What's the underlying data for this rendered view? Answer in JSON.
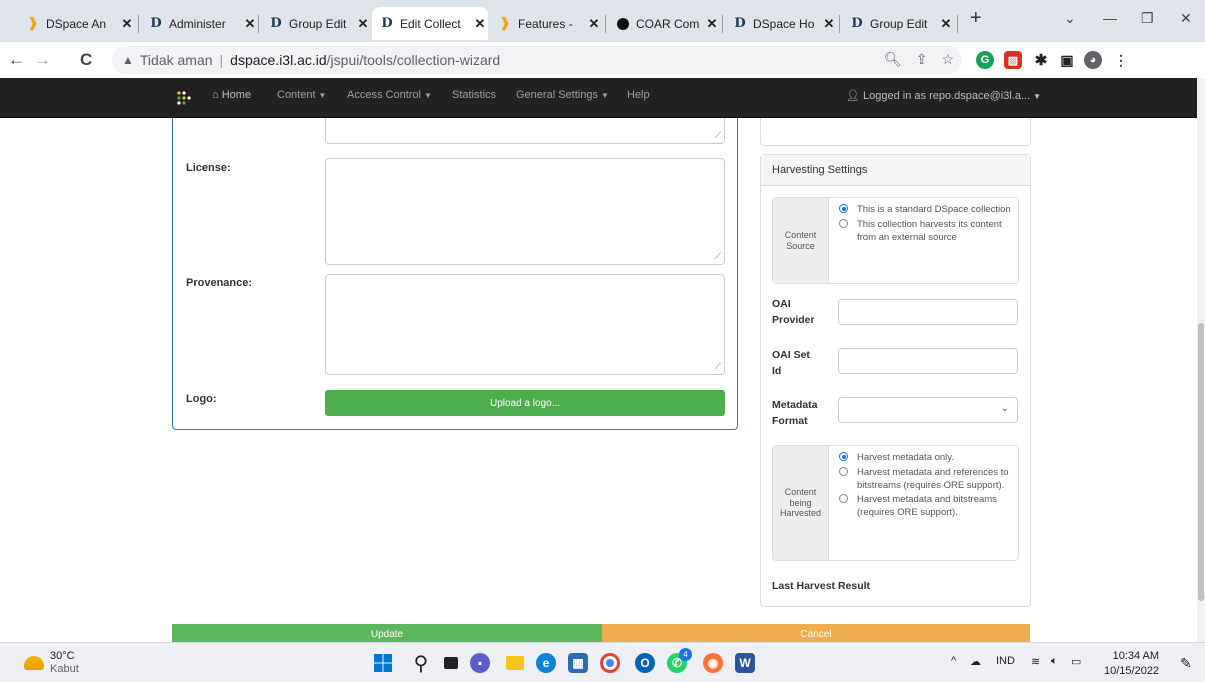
{
  "browser": {
    "tabs": [
      {
        "label": "DSpace An",
        "icon": "dspace-angular-icon"
      },
      {
        "label": "Administer",
        "icon": "dspace-d-icon"
      },
      {
        "label": "Group Edit",
        "icon": "dspace-d-icon"
      },
      {
        "label": "Edit Collect",
        "icon": "dspace-d-icon",
        "active": true
      },
      {
        "label": "Features -",
        "icon": "dspace-angular-icon"
      },
      {
        "label": "COAR Com",
        "icon": "coar-icon"
      },
      {
        "label": "DSpace Ho",
        "icon": "dspace-d-icon"
      },
      {
        "label": "Group Edit",
        "icon": "dspace-d-icon"
      }
    ],
    "new_tab": "+",
    "address": {
      "security_label": "Tidak aman",
      "host": "dspace.i3l.ac.id",
      "path": "/jspui/tools/collection-wizard"
    }
  },
  "navbar": {
    "home": "Home",
    "items": [
      "Content",
      "Access Control",
      "Statistics",
      "General Settings",
      "Help"
    ],
    "user": "Logged in as repo.dspace@i3l.a..."
  },
  "form": {
    "license_label": "License:",
    "provenance_label": "Provenance:",
    "logo_label": "Logo:",
    "upload_logo": "Upload a logo..."
  },
  "harvesting": {
    "title": "Harvesting Settings",
    "content_source_label": "Content Source",
    "content_source_options": [
      {
        "text": "This is a standard DSpace collection",
        "selected": true
      },
      {
        "text": "This collection harvests its content from an external source",
        "selected": false
      }
    ],
    "oai_provider_label": "OAI Provider",
    "oai_set_label": "OAI Set Id",
    "metadata_format_label": "Metadata Format",
    "content_harvested_label": "Content being Harvested",
    "harvest_options": [
      {
        "text": "Harvest metadata only.",
        "selected": true
      },
      {
        "text": "Harvest metadata and references to bitstreams (requires ORE support).",
        "selected": false
      },
      {
        "text": "Harvest metadata and bitstreams (requires ORE support).",
        "selected": false
      }
    ],
    "last_result_label": "Last Harvest Result"
  },
  "actions": {
    "update": "Update",
    "cancel": "Cancel"
  },
  "taskbar": {
    "temperature": "30°C",
    "condition": "Kabut",
    "language": "IND",
    "time": "10:34 AM",
    "date": "10/15/2022",
    "badge_count": "4"
  },
  "colors": {
    "navbar": "#222222",
    "green": "#5cb85c",
    "orange": "#f0ad4e",
    "panel_border": "#337ab7"
  }
}
